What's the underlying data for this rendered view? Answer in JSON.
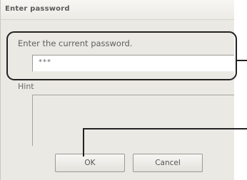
{
  "window": {
    "title": "Enter password"
  },
  "password_prompt": {
    "label": "Enter the current password.",
    "value": "***"
  },
  "hint": {
    "label": "Hint",
    "value": ""
  },
  "buttons": {
    "ok_label": "OK",
    "cancel_label": "Cancel"
  }
}
